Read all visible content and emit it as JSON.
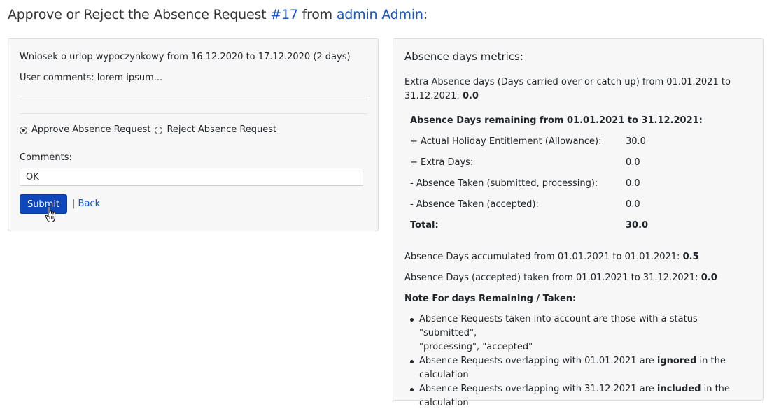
{
  "header": {
    "title_prefix": "Approve or Reject the Absence Request ",
    "request_id": "#17",
    "title_mid": " from ",
    "user_name": "admin Admin",
    "title_suffix": ":"
  },
  "request": {
    "summary": "Wniosek o urlop wypoczynkowy from 16.12.2020 to 17.12.2020 (2 days)",
    "user_comments": "User comments: lorem ipsum..."
  },
  "form": {
    "approve_label": "Approve Absence Request",
    "reject_label": "Reject Absence Request",
    "comments_label": "Comments:",
    "comments_value": "OK",
    "submit_label": "Submit",
    "separator": "|",
    "back_label": "Back"
  },
  "metrics": {
    "title": "Absence days metrics:",
    "extra_line1": "Extra Absence days (Days carried over or catch up) from 01.01.2021 to",
    "extra_line2_prefix": "31.12.2021: ",
    "extra_value": "0.0",
    "remaining_header": "Absence Days remaining from 01.01.2021 to 31.12.2021:",
    "rows": [
      {
        "label": "+ Actual Holiday Entitlement (Allowance):",
        "value": "30.0"
      },
      {
        "label": "+ Extra Days:",
        "value": "0.0"
      },
      {
        "label": "- Absence Taken (submitted, processing):",
        "value": "0.0"
      },
      {
        "label": "- Absence Taken (accepted):",
        "value": "0.0"
      }
    ],
    "total_label": "Total:",
    "total_value": "30.0",
    "accumulated_prefix": "Absence Days accumulated from 01.01.2021 to 01.01.2021: ",
    "accumulated_value": "0.5",
    "taken_prefix": "Absence Days (accepted) taken from 01.01.2021 to 31.12.2021: ",
    "taken_value": "0.0",
    "note_title": "Note For days Remaining / Taken:",
    "note1_line1": "Absence Requests taken into account are those with a status \"submitted\",",
    "note1_line2": "\"processing\", \"accepted\"",
    "note2_prefix": "Absence Requests overlapping with 01.01.2021 are ",
    "note2_bold": "ignored",
    "note2_suffix": " in the calculation",
    "note3_prefix": "Absence Requests overlapping with 31.12.2021 are ",
    "note3_bold": "included",
    "note3_suffix": " in the",
    "note3_line2": "calculation"
  }
}
